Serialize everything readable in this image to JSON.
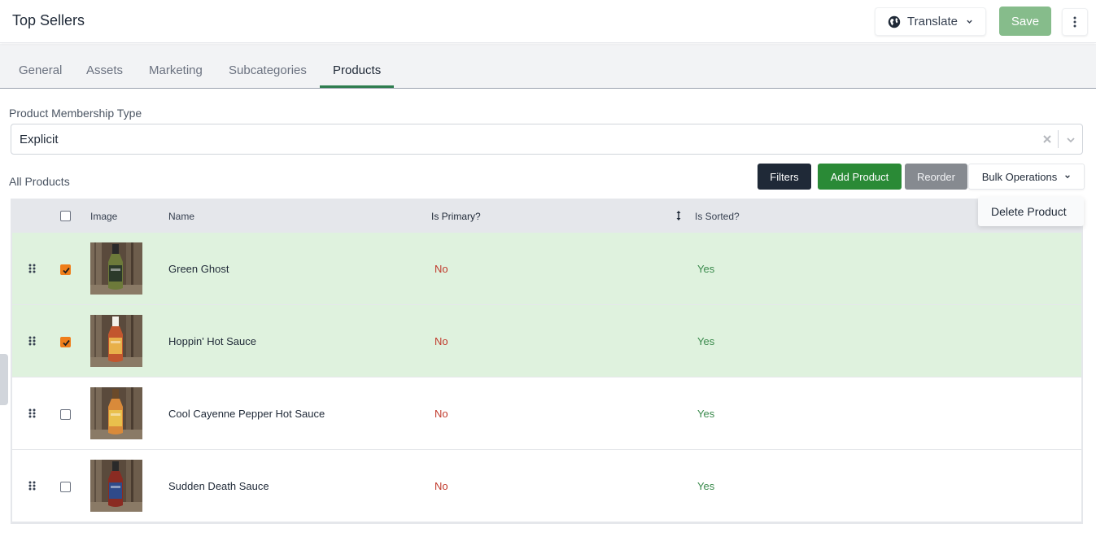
{
  "header": {
    "title": "Top Sellers",
    "translate_label": "Translate",
    "save_label": "Save"
  },
  "tabs": [
    {
      "label": "General",
      "active": false
    },
    {
      "label": "Assets",
      "active": false
    },
    {
      "label": "Marketing",
      "active": false
    },
    {
      "label": "Subcategories",
      "active": false
    },
    {
      "label": "Products",
      "active": true
    }
  ],
  "membership": {
    "label": "Product Membership Type",
    "value": "Explicit"
  },
  "products_section": {
    "label": "All Products",
    "buttons": {
      "filters": "Filters",
      "add_product": "Add Product",
      "reorder": "Reorder",
      "bulk_operations": "Bulk Operations"
    },
    "bulk_menu": {
      "items": [
        "Delete Product"
      ]
    }
  },
  "table": {
    "columns": [
      "Image",
      "Name",
      "Is Primary?",
      "Is Sorted?"
    ],
    "rows": [
      {
        "name": "Green Ghost",
        "is_primary": "No",
        "is_sorted": "Yes",
        "selected": true,
        "bottle": {
          "body": "#6d7a3a",
          "label": "#2c3a2a",
          "cap": "#2a2a2a"
        }
      },
      {
        "name": "Hoppin' Hot Sauce",
        "is_primary": "No",
        "is_sorted": "Yes",
        "selected": true,
        "bottle": {
          "body": "#c2562e",
          "label": "#e8b04a",
          "cap": "#f4f1ea"
        }
      },
      {
        "name": "Cool Cayenne Pepper Hot Sauce",
        "is_primary": "No",
        "is_sorted": "Yes",
        "selected": false,
        "bottle": {
          "body": "#d98a3a",
          "label": "#e9c04c",
          "cap": "#6b4a2a"
        }
      },
      {
        "name": "Sudden Death Sauce",
        "is_primary": "No",
        "is_sorted": "Yes",
        "selected": false,
        "bottle": {
          "body": "#8a2b22",
          "label": "#2f4a8a",
          "cap": "#2a2a2a"
        }
      }
    ]
  },
  "colors": {
    "accent_green": "#2a8a36",
    "save_disabled": "#86bc8b",
    "tab_underline": "#2e7d4f",
    "selected_row": "#dff2de",
    "checkbox_checked": "#ef7e1a",
    "no_text": "#c0392b",
    "yes_text": "#3a8a4c"
  }
}
